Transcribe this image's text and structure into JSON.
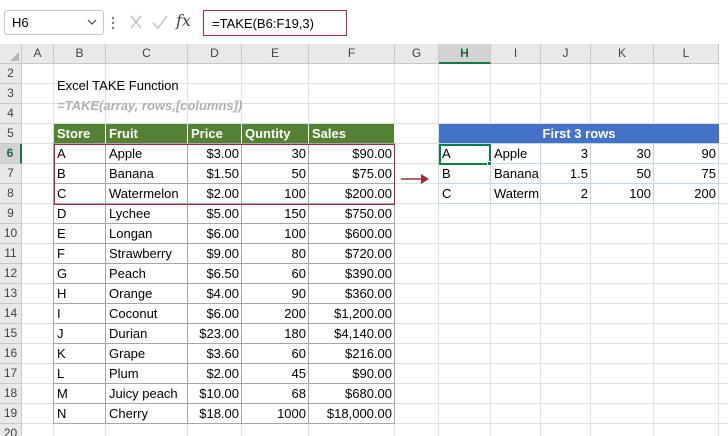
{
  "formula_bar": {
    "name_box": "H6",
    "formula": "=TAKE(B6:F19,3)",
    "fx_label": "fx"
  },
  "columns": [
    "A",
    "B",
    "C",
    "D",
    "E",
    "F",
    "G",
    "H",
    "I",
    "J",
    "K",
    "L"
  ],
  "selected_column": "H",
  "rows": [
    "2",
    "3",
    "4",
    "5",
    "6",
    "7",
    "8",
    "9",
    "10",
    "11",
    "12",
    "13",
    "14",
    "15",
    "16",
    "17",
    "18",
    "19",
    "20"
  ],
  "selected_row": "6",
  "heading": {
    "title": "Excel TAKE Function",
    "syntax": "=TAKE(array, rows,[columns])"
  },
  "source_table": {
    "headers": [
      "Store",
      "Fruit",
      "Price",
      "Quntity",
      "Sales"
    ],
    "rows": [
      [
        "A",
        "Apple",
        "$3.00",
        "30",
        "$90.00"
      ],
      [
        "B",
        "Banana",
        "$1.50",
        "50",
        "$75.00"
      ],
      [
        "C",
        "Watermelon",
        "$2.00",
        "100",
        "$200.00"
      ],
      [
        "D",
        "Lychee",
        "$5.00",
        "150",
        "$750.00"
      ],
      [
        "E",
        "Longan",
        "$6.00",
        "100",
        "$600.00"
      ],
      [
        "F",
        "Strawberry",
        "$9.00",
        "80",
        "$720.00"
      ],
      [
        "G",
        "Peach",
        "$6.50",
        "60",
        "$390.00"
      ],
      [
        "H",
        "Orange",
        "$4.00",
        "90",
        "$360.00"
      ],
      [
        "I",
        "Coconut",
        "$6.00",
        "200",
        "$1,200.00"
      ],
      [
        "J",
        "Durian",
        "$23.00",
        "180",
        "$4,140.00"
      ],
      [
        "K",
        "Grape",
        "$3.60",
        "60",
        "$216.00"
      ],
      [
        "L",
        "Plum",
        "$2.00",
        "45",
        "$90.00"
      ],
      [
        "M",
        "Juicy peach",
        "$10.00",
        "68",
        "$680.00"
      ],
      [
        "N",
        "Cherry",
        "$18.00",
        "1000",
        "$18,000.00"
      ]
    ]
  },
  "result_table": {
    "title": "First 3 rows",
    "rows": [
      [
        "A",
        "Apple",
        "3",
        "30",
        "90"
      ],
      [
        "B",
        "Banana",
        "1.5",
        "50",
        "75"
      ],
      [
        "C",
        "Waterm",
        "2",
        "100",
        "200"
      ]
    ]
  },
  "colors": {
    "table_header": "#548235",
    "result_header": "#4472c4",
    "highlight_border": "#9e2a3f",
    "arrow": "#9e2a3f",
    "selection": "#107c41"
  }
}
